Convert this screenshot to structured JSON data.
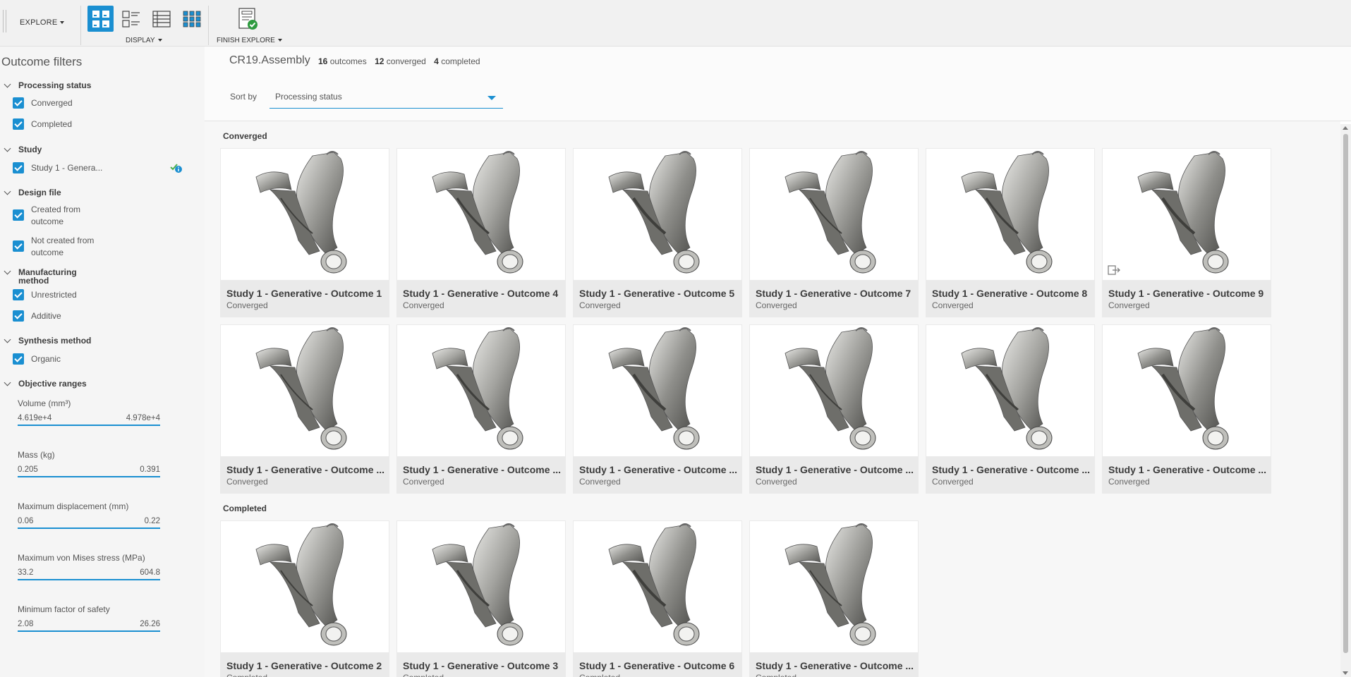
{
  "toolbar": {
    "explore_label": "EXPLORE",
    "display_label": "DISPLAY",
    "finish_label": "FINISH EXPLORE"
  },
  "sidebar": {
    "title": "Outcome filters",
    "groups": [
      {
        "label": "Processing status",
        "items": [
          "Converged",
          "Completed"
        ]
      },
      {
        "label": "Study",
        "items": [
          "Study 1 - Genera..."
        ]
      },
      {
        "label": "Design file",
        "items": [
          "Created from outcome",
          "Not created from outcome"
        ]
      },
      {
        "label": "Manufacturing method",
        "items": [
          "Unrestricted",
          "Additive"
        ]
      },
      {
        "label": "Synthesis method",
        "items": [
          "Organic"
        ]
      },
      {
        "label": "Objective ranges",
        "items": []
      }
    ],
    "ranges": [
      {
        "label": "Volume (mm³)",
        "min": "4.619e+4",
        "max": "4.978e+4"
      },
      {
        "label": "Mass (kg)",
        "min": "0.205",
        "max": "0.391"
      },
      {
        "label": "Maximum displacement (mm)",
        "min": "0.06",
        "max": "0.22"
      },
      {
        "label": "Maximum von Mises stress (MPa)",
        "min": "33.2",
        "max": "604.8"
      },
      {
        "label": "Minimum factor of safety",
        "min": "2.08",
        "max": "26.26"
      }
    ]
  },
  "header": {
    "title": "CR19.Assembly",
    "outcomes_count": "16",
    "outcomes_label": "outcomes",
    "converged_count": "12",
    "converged_label": "converged",
    "completed_count": "4",
    "completed_label": "completed",
    "sort_label": "Sort by",
    "sort_value": "Processing status"
  },
  "sections": [
    {
      "label": "Converged",
      "cards": [
        {
          "name": "Study 1 - Generative - Outcome 1",
          "status": "Converged"
        },
        {
          "name": "Study 1 - Generative - Outcome 4",
          "status": "Converged"
        },
        {
          "name": "Study 1 - Generative - Outcome 5",
          "status": "Converged"
        },
        {
          "name": "Study 1 - Generative - Outcome 7",
          "status": "Converged"
        },
        {
          "name": "Study 1 - Generative - Outcome 8",
          "status": "Converged"
        },
        {
          "name": "Study 1 - Generative - Outcome 9",
          "status": "Converged"
        },
        {
          "name": "Study 1 - Generative - Outcome ...",
          "status": "Converged"
        },
        {
          "name": "Study 1 - Generative - Outcome ...",
          "status": "Converged"
        },
        {
          "name": "Study 1 - Generative - Outcome ...",
          "status": "Converged"
        },
        {
          "name": "Study 1 - Generative - Outcome ...",
          "status": "Converged"
        },
        {
          "name": "Study 1 - Generative - Outcome ...",
          "status": "Converged"
        },
        {
          "name": "Study 1 - Generative - Outcome ...",
          "status": "Converged"
        }
      ]
    },
    {
      "label": "Completed",
      "cards": [
        {
          "name": "Study 1 - Generative - Outcome 2",
          "status": "Completed"
        },
        {
          "name": "Study 1 - Generative - Outcome 3",
          "status": "Completed"
        },
        {
          "name": "Study 1 - Generative - Outcome 6",
          "status": "Completed"
        },
        {
          "name": "Study 1 - Generative - Outcome ...",
          "status": "Completed"
        }
      ]
    }
  ],
  "colors": {
    "accent": "#1a8fd1",
    "sidebar_bg": "#f5f5f5",
    "content_bg": "#f7f7f7"
  },
  "icons": [
    "grid-view-icon",
    "large-list-view-icon",
    "table-view-icon",
    "small-grid-view-icon",
    "finish-explore-icon",
    "export-icon",
    "study-badge-icon"
  ]
}
